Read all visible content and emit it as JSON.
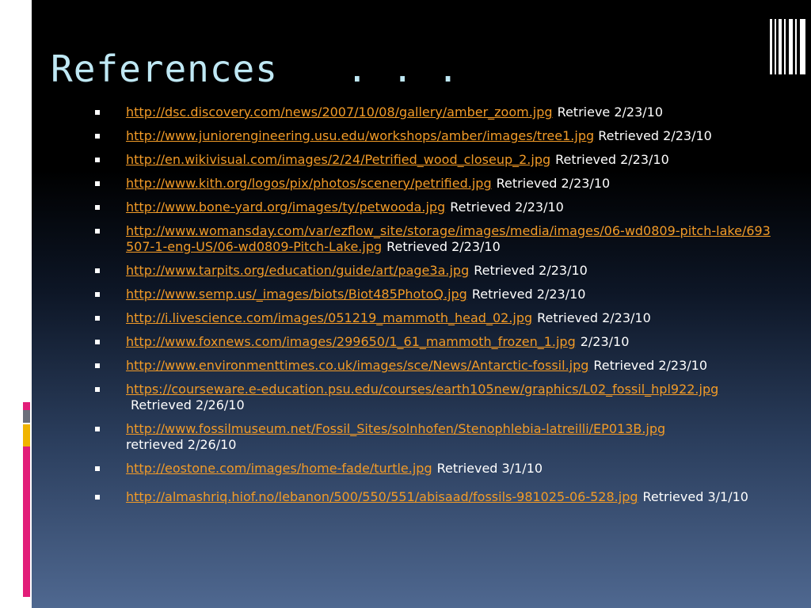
{
  "slide": {
    "title": "References   . . .",
    "colors": {
      "link": "#f29b27",
      "title": "#bfe8f4",
      "accent_pink": "#e21e79",
      "accent_gold": "#f0b400"
    }
  },
  "references": [
    {
      "url": "http://dsc.discovery.com/news/2007/10/08/gallery/amber_zoom.jpg",
      "note": "Retrieve 2/23/10"
    },
    {
      "url": "http://www.juniorengineering.usu.edu/workshops/amber/images/tree1.jpg",
      "note": "Retrieved 2/23/10"
    },
    {
      "url": "http://en.wikivisual.com/images/2/24/Petrified_wood_closeup_2.jpg",
      "note": "Retrieved 2/23/10"
    },
    {
      "url": "http://www.kith.org/logos/pix/photos/scenery/petrified.jpg",
      "note": "Retrieved 2/23/10"
    },
    {
      "url": "http://www.bone-yard.org/images/ty/petwooda.jpg",
      "note": "Retrieved 2/23/10"
    },
    {
      "url": "http://www.womansday.com/var/ezflow_site/storage/images/media/images/06-wd0809-pitch-lake/693507-1-eng-US/06-wd0809-Pitch-Lake.jpg",
      "note": "Retrieved 2/23/10"
    },
    {
      "url": "http://www.tarpits.org/education/guide/art/page3a.jpg",
      "note": "Retrieved 2/23/10"
    },
    {
      "url": "http://www.semp.us/_images/biots/Biot485PhotoQ.jpg",
      "note": "Retrieved 2/23/10"
    },
    {
      "url": "http://i.livescience.com/images/051219_mammoth_head_02.jpg",
      "note": "Retrieved 2/23/10"
    },
    {
      "url": "http://www.foxnews.com/images/299650/1_61_mammoth_frozen_1.jpg",
      "note": "2/23/10"
    },
    {
      "url": "http://www.environmenttimes.co.uk/images/sce/News/Antarctic-fossil.jpg",
      "note": "Retrieved 2/23/10"
    },
    {
      "url": "https://courseware.e-education.psu.edu/courses/earth105new/graphics/L02_fossil_hpl922.jpg",
      "note": "Retrieved 2/26/10"
    },
    {
      "url": "http://www.fossilmuseum.net/Fossil_Sites/solnhofen/Stenophlebia-latreilli/EP013B.jpg",
      "note": "retrieved 2/26/10"
    },
    {
      "url": "http://eostone.com/images/home-fade/turtle.jpg",
      "note": "Retrieved 3/1/10"
    },
    {
      "url": "http://almashriq.hiof.no/lebanon/500/550/551/abisaad/fossils-981025-06-528.jpg",
      "note": "Retrieved 3/1/10"
    }
  ]
}
